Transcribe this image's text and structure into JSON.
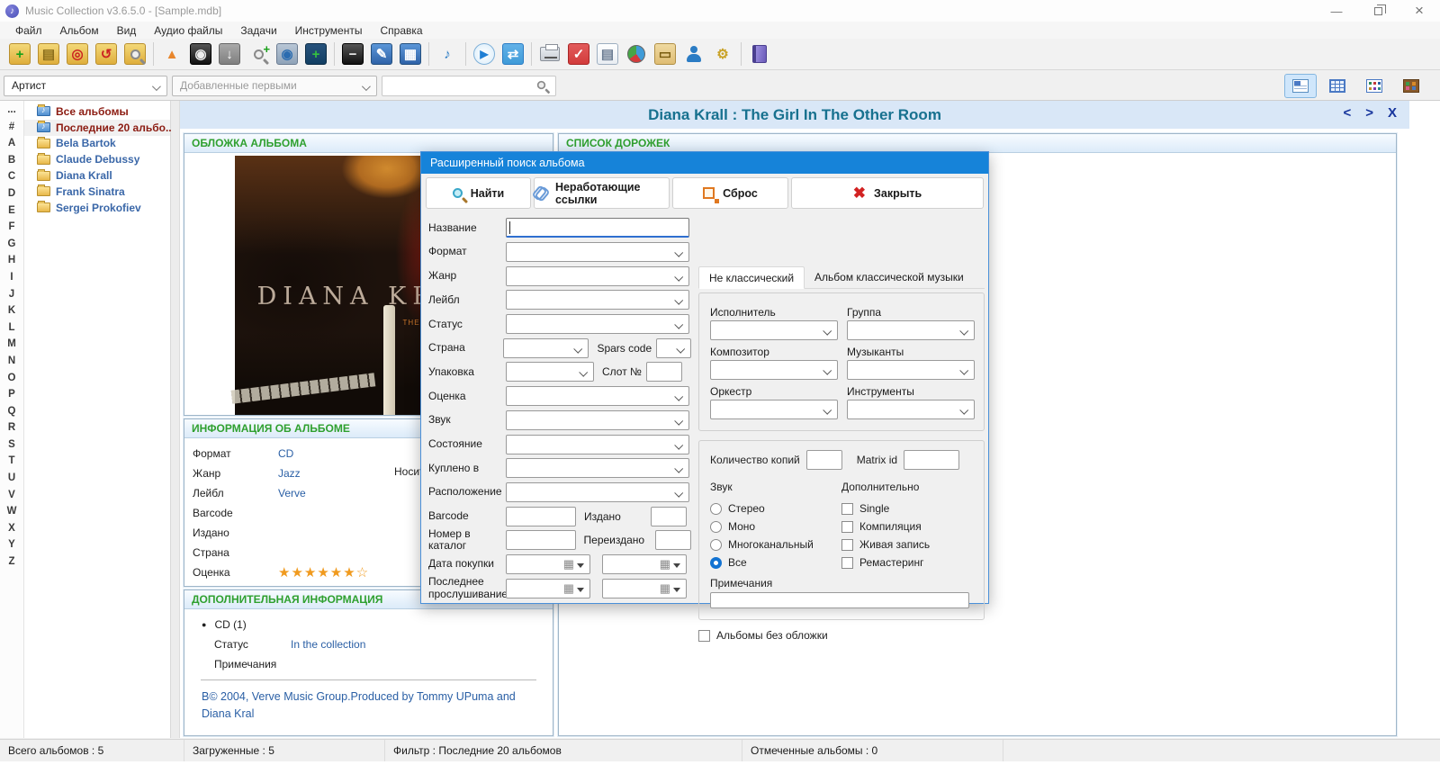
{
  "window": {
    "title": "Music Collection v3.6.5.0 - [Sample.mdb]",
    "icon_glyph": "♪",
    "min_glyph": "—",
    "close_glyph": "×"
  },
  "menu": {
    "items": [
      "Файл",
      "Альбом",
      "Вид",
      "Аудио файлы",
      "Задачи",
      "Инструменты",
      "Справка"
    ]
  },
  "toolbar": {
    "glyphs": {
      "add": "+",
      "copy": "▤",
      "repair": "◎",
      "restore": "↺",
      "eject": "▲",
      "cdtext": "◉",
      "download": "↓",
      "add_disc": "+",
      "remove": "−",
      "edit": "✎",
      "table": "▦",
      "play": "▶",
      "shuffle": "⇄",
      "tasks": "✓",
      "report": "▤",
      "loans": "▭",
      "gear": "⚙"
    }
  },
  "filterbar": {
    "category": "Артист",
    "sort": "Добавленные первыми",
    "search_value": ""
  },
  "sidebar": {
    "alphabet": [
      "...",
      "#",
      "A",
      "B",
      "C",
      "D",
      "E",
      "F",
      "G",
      "H",
      "I",
      "J",
      "K",
      "L",
      "M",
      "N",
      "O",
      "P",
      "Q",
      "R",
      "S",
      "T",
      "U",
      "V",
      "W",
      "X",
      "Y",
      "Z"
    ],
    "items": [
      {
        "label": "Все альбомы",
        "cls": "db",
        "name": "tree-item-all-albums"
      },
      {
        "label": "Последние 20 альбо...",
        "cls": "dbsel",
        "name": "tree-item-last-20-albums"
      },
      {
        "label": "Bela Bartok",
        "cls": "artist",
        "name": "tree-item-bela-bartok"
      },
      {
        "label": "Claude Debussy",
        "cls": "artist",
        "name": "tree-item-claude-debussy"
      },
      {
        "label": "Diana Krall",
        "cls": "artist",
        "name": "tree-item-diana-krall"
      },
      {
        "label": "Frank Sinatra",
        "cls": "artist",
        "name": "tree-item-frank-sinatra"
      },
      {
        "label": "Sergei Prokofiev",
        "cls": "artist",
        "name": "tree-item-sergei-prokofiev"
      }
    ]
  },
  "main": {
    "title": "Diana Krall : The Girl In The Other Room",
    "nav": {
      "prev": "<",
      "next": ">",
      "close": "X"
    },
    "cover_section": {
      "title": "ОБЛОЖКА АЛЬБОМА",
      "artist_text": "DIANA KRALL",
      "album_text": "THE GIRL IN THE OTHER ROOM"
    },
    "tracks_section": {
      "title": "СПИСОК ДОРОЖЕК"
    },
    "info_section": {
      "title": "ИНФОРМАЦИЯ ОБ АЛЬБОМЕ",
      "rows": [
        {
          "label": "Формат",
          "value": "CD"
        },
        {
          "label": "Жанр",
          "value": "Jazz"
        },
        {
          "label": "Лейбл",
          "value": "Verve"
        },
        {
          "label": "Barcode",
          "value": ""
        },
        {
          "label": "Издано",
          "value": ""
        },
        {
          "label": "Страна",
          "value": ""
        }
      ],
      "col2_label": "Носитель",
      "rating_label": "Оценка",
      "stars_filled": "★★★★★★",
      "star_empty": "☆"
    },
    "extra_section": {
      "title": "ДОПОЛНИТЕЛЬНАЯ ИНФОРМАЦИЯ",
      "bullet": "CD (1)",
      "status_label": "Статус",
      "status_value": "In the collection",
      "notes_label": "Примечания",
      "note": "В© 2004, Verve Music Group.Produced by Tommy UPuma and Diana Kral"
    }
  },
  "dialog": {
    "title": "Расширенный поиск альбома",
    "buttons": {
      "find": "Найти",
      "broken_links": "Неработающие ссылки",
      "reset": "Сброс",
      "close": "Закрыть"
    },
    "left": {
      "name": "Название",
      "format": "Формат",
      "genre": "Жанр",
      "label": "Лейбл",
      "status": "Статус",
      "country": "Страна",
      "spars": "Spars code",
      "packaging": "Упаковка",
      "slot": "Слот №",
      "rating": "Оценка",
      "sound": "Звук",
      "condition": "Состояние",
      "purchased_at": "Куплено в",
      "location": "Расположение",
      "barcode": "Barcode",
      "released": "Издано",
      "catalog": "Номер в каталог",
      "reissued": "Переиздано",
      "purchase_date": "Дата покупки",
      "last_played": "Последнее прослушивание"
    },
    "tabs": {
      "active": "Не классический",
      "inactive": "Альбом классической музыки"
    },
    "artists": {
      "performer": "Исполнитель",
      "group": "Группа",
      "composer": "Композитор",
      "musicians": "Музыканты",
      "orchestra": "Оркестр",
      "instruments": "Инструменты"
    },
    "misc": {
      "copies": "Количество копий",
      "matrix": "Matrix id",
      "sound_group": "Звук",
      "radios": [
        "Стерео",
        "Моно",
        "Многоканальный",
        "Все"
      ],
      "radio_selected": "Все",
      "extra_group": "Дополнительно",
      "checkboxes": [
        "Single",
        "Компиляция",
        "Живая запись",
        "Ремастеринг"
      ],
      "notes": "Примечания",
      "no_cover": "Альбомы без обложки"
    }
  },
  "statusbar": {
    "segments": [
      "Всего альбомов : 5",
      "Загруженные : 5",
      "Фильтр : Последние 20 альбомов",
      "Отмеченные альбомы : 0"
    ]
  },
  "colors": {
    "dialog_titlebar": "#1683d9",
    "header_band": "#d9e7f7",
    "header_title": "#17718f",
    "section_title_green": "#2fa02f",
    "link_blue": "#2a5fa5",
    "star_orange": "#f09a1e",
    "tree_special_red": "#8c1c12",
    "radio_selected_blue": "#1273d2"
  }
}
